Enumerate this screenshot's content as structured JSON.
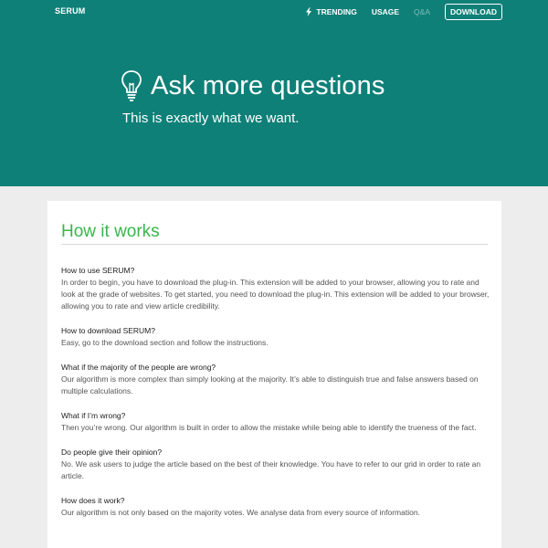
{
  "header": {
    "brand": "SERUM",
    "nav": {
      "trending": "TRENDING",
      "usage": "USAGE",
      "qa": "Q&A",
      "download": "DOWNLOAD"
    }
  },
  "hero": {
    "title": "Ask more questions",
    "subtitle": "This is exactly what we want."
  },
  "section": {
    "title": "How it works",
    "faq": [
      {
        "q": "How to use SERUM?",
        "a": "In order to begin, you have to download the plug-in. This extension will be added to your browser, allowing you to rate and look at the grade of websites. To get started, you need to download the plug-in. This extension will be added to your browser, allowing you to rate and view article credibility."
      },
      {
        "q": "How to download SERUM?",
        "a": "Easy, go to the download section and follow the instructions."
      },
      {
        "q": "What if the majority of the people are wrong?",
        "a": "Our algorithm is more complex than simply looking at the majority. It’s able to distinguish true and false answers based on multiple calculations."
      },
      {
        "q": "What if I’m wrong?",
        "a": "Then you’re wrong. Our algorithm is built in order to allow the mistake while being able to identify the trueness of the fact."
      },
      {
        "q": "Do people give their opinion?",
        "a": "No. We ask users to judge the article based on the best of their knowledge. You have to refer to our grid in order to rate an article."
      },
      {
        "q": "How does it work?",
        "a": "Our algorithm is not only based on the majority votes. We analyse data from every source of information."
      }
    ]
  },
  "colors": {
    "hero_bg": "#0f8078",
    "title_green": "#3ab54a",
    "page_bg": "#ededed"
  },
  "icons": [
    "lightning-icon",
    "lightbulb-icon"
  ]
}
